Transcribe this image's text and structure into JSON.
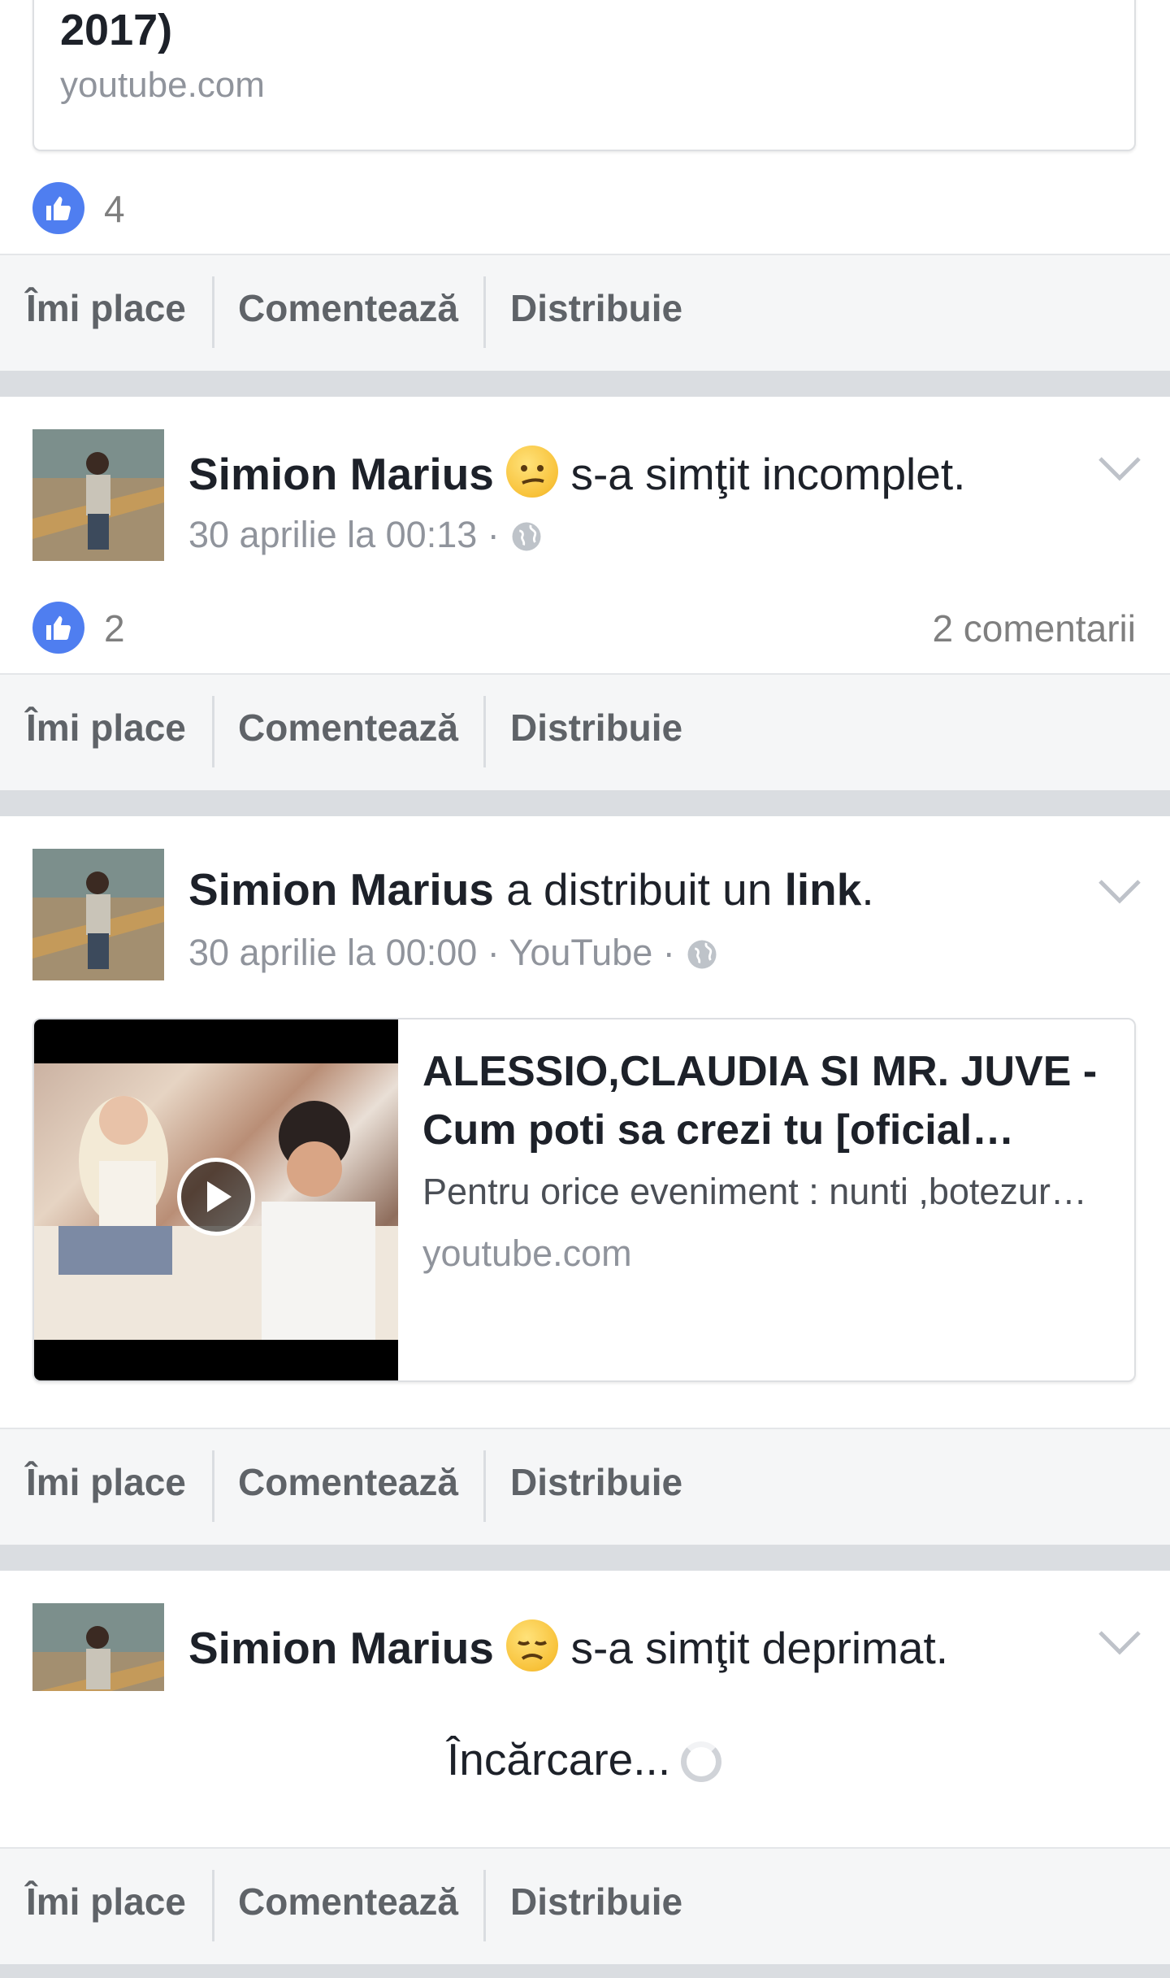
{
  "previous_post": {
    "card_title_tail": "2017)",
    "card_domain": "youtube.com",
    "like_count": "4"
  },
  "actions": {
    "like": "Îmi place",
    "comment": "Comentează",
    "share": "Distribuie"
  },
  "post1": {
    "author": "Simion Marius",
    "feeling_text": "s-a simţit incomplet.",
    "timestamp": "30 aprilie la 00:13 ·",
    "like_count": "2",
    "comments": "2 comentarii"
  },
  "post2": {
    "author": "Simion Marius",
    "shared_text": "a distribuit un",
    "link_word": "link",
    "period": ".",
    "timestamp": "30 aprilie la 00:00 · YouTube ·",
    "card": {
      "title": "ALESSIO,CLAUDIA SI MR. JUVE - Cum poti sa crezi tu [oficial…",
      "description": "Pentru orice eveniment : nunti ,botezur…",
      "domain": "youtube.com"
    }
  },
  "post3": {
    "author": "Simion Marius",
    "feeling_text": "s-a simţit deprimat."
  },
  "loading": {
    "text": "Încărcare..."
  },
  "colors": {
    "like_blue": "#4f7ef0",
    "divider": "#dadde1",
    "action_bg": "#f5f6f7"
  }
}
